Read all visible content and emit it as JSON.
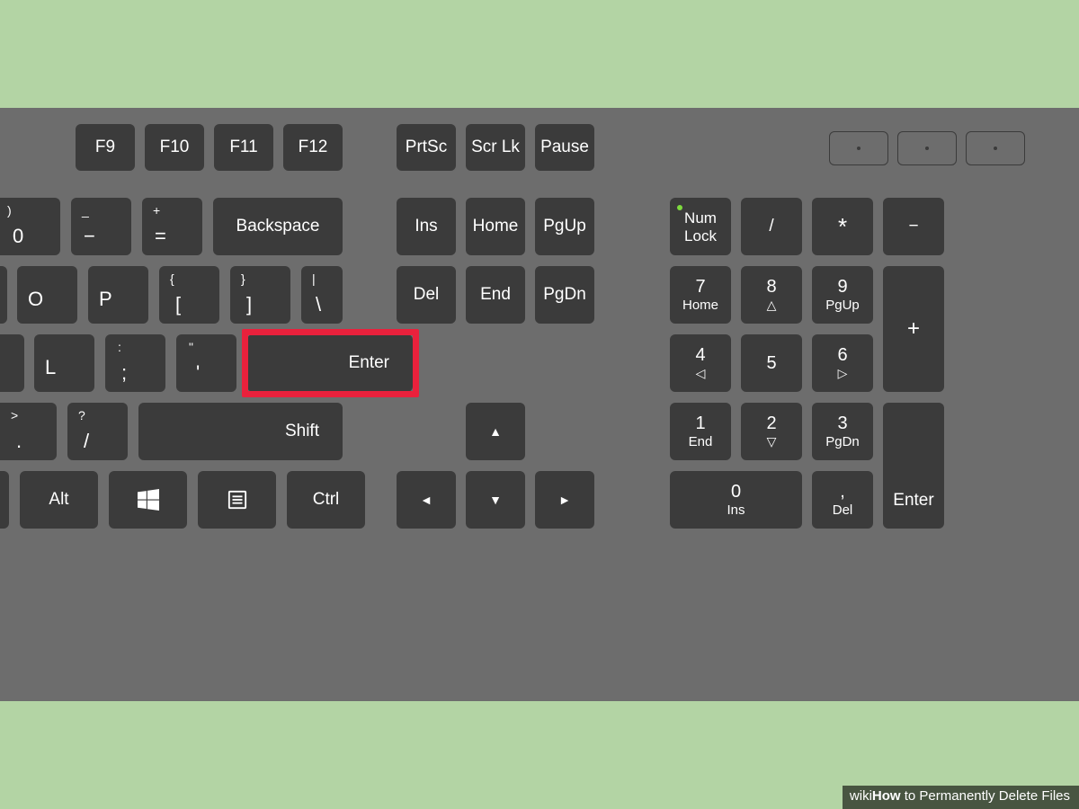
{
  "caption": {
    "wiki": "wiki",
    "how": "How",
    "rest": " to Permanently Delete Files"
  },
  "highlight_key": "Enter",
  "keys": {
    "f9": "F9",
    "f10": "F10",
    "f11": "F11",
    "f12": "F12",
    "prtsc": "PrtSc",
    "scrlk": "Scr Lk",
    "pause": "Pause",
    "zero_top": ")",
    "zero": "0",
    "minus_top": "_",
    "minus": "−",
    "equals_top": "+",
    "equals": "=",
    "backspace": "Backspace",
    "ins": "Ins",
    "home": "Home",
    "pgup": "PgUp",
    "numlock_a": "Num",
    "numlock_b": "Lock",
    "np_slash": "/",
    "np_star": "*",
    "np_minus": "−",
    "o": "O",
    "p": "P",
    "lbr_top": "{",
    "lbr": "[",
    "rbr_top": "}",
    "rbr": "]",
    "bslash_top": "|",
    "bslash": "\\",
    "del": "Del",
    "end": "End",
    "pgdn": "PgDn",
    "np7": "7",
    "np7s": "Home",
    "np8": "8",
    "np8s": "△",
    "np9": "9",
    "np9s": "PgUp",
    "np_plus": "+",
    "l": "L",
    "semi_top": ":",
    "semi": ";",
    "quote_top": "\"",
    "quote": "'",
    "enter": "Enter",
    "np4": "4",
    "np4s": "◁",
    "np5": "5",
    "np6": "6",
    "np6s": "▷",
    "period_top": ">",
    "period": ".",
    "slash_top": "?",
    "slash": "/",
    "shift": "Shift",
    "np1": "1",
    "np1s": "End",
    "np2": "2",
    "np2s": "▽",
    "np3": "3",
    "np3s": "PgDn",
    "np_enter": "Enter",
    "alt": "Alt",
    "ctrl": "Ctrl",
    "arrow_up": "▲",
    "arrow_left": "◄",
    "arrow_down": "▼",
    "arrow_right": "►",
    "np0": "0",
    "np0s": "Ins",
    "np_dot": ",",
    "np_dots": "Del"
  }
}
